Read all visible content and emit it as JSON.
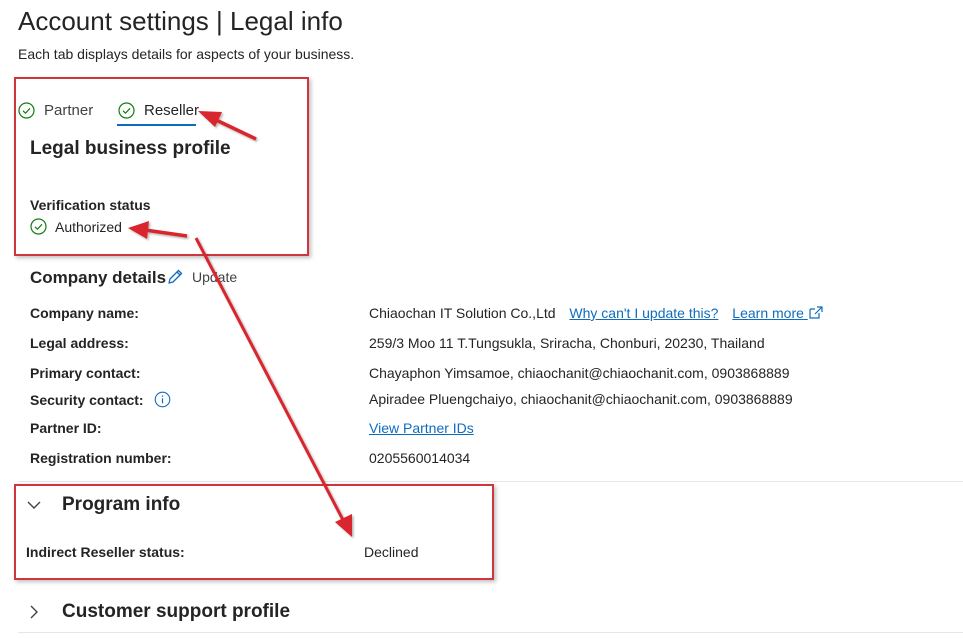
{
  "header": {
    "title": "Account settings",
    "separator": "|",
    "section": "Legal info",
    "subtitle": "Each tab displays details for aspects of your business."
  },
  "tabs": [
    {
      "label": "Partner",
      "icon": "check-circle-icon",
      "selected": false
    },
    {
      "label": "Reseller",
      "icon": "check-circle-icon",
      "selected": true
    }
  ],
  "profile": {
    "title": "Legal business profile",
    "verification_label": "Verification status",
    "verification_value": "Authorized"
  },
  "company": {
    "title": "Company details",
    "update_label": "Update",
    "rows": [
      {
        "label": "Company name:",
        "value": "Chiaochan IT Solution Co.,Ltd",
        "link1": "Why can't I update this?",
        "link2": "Learn more"
      },
      {
        "label": "Legal address:",
        "value": "259/3 Moo 11 T.Tungsukla, Sriracha, Chonburi, 20230, Thailand"
      },
      {
        "label": "Primary contact:",
        "value": "Chayaphon Yimsamoe, chiaochanit@chiaochanit.com, 0903868889"
      },
      {
        "label": "Security contact:",
        "value": "Apiradee Pluengchaiyo, chiaochanit@chiaochanit.com, 0903868889"
      },
      {
        "label": "Partner ID:",
        "value": "View Partner IDs"
      },
      {
        "label": "Registration number:",
        "value": "0205560014034"
      }
    ]
  },
  "program": {
    "title": "Program info",
    "status_label": "Indirect Reseller status:",
    "status_value": "Declined"
  },
  "support": {
    "title": "Customer support profile"
  },
  "colors": {
    "accent": "#0f6cbd",
    "success": "#107c10",
    "annotation": "#d0343c"
  }
}
